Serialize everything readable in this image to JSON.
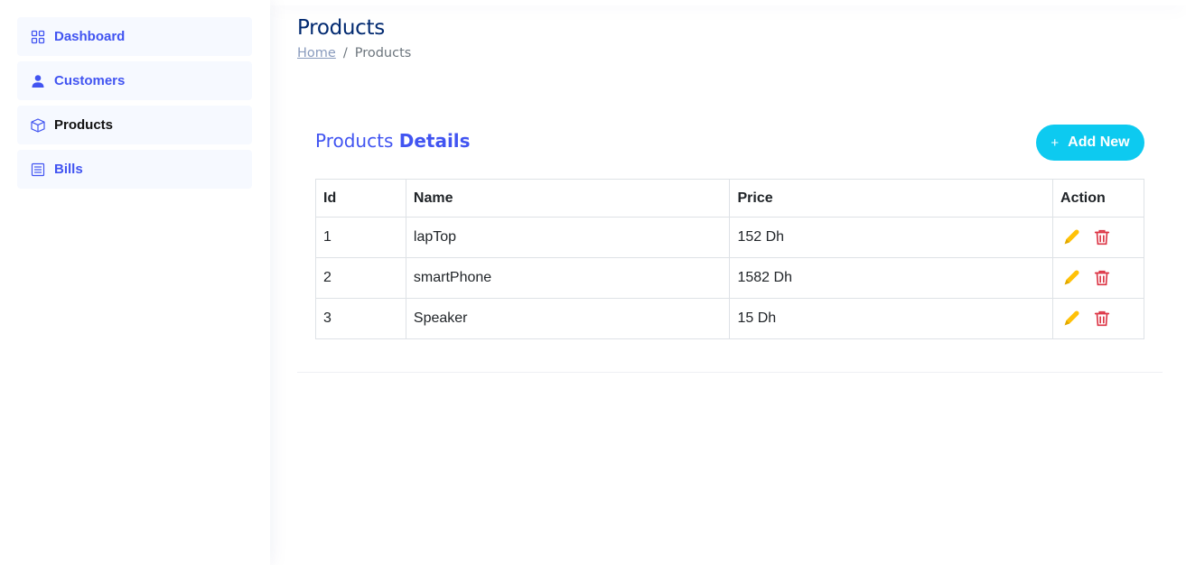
{
  "sidebar": {
    "items": [
      {
        "label": "Dashboard",
        "icon": "grid-icon"
      },
      {
        "label": "Customers",
        "icon": "person-icon"
      },
      {
        "label": "Products",
        "icon": "box-icon"
      },
      {
        "label": "Bills",
        "icon": "receipt-icon"
      }
    ]
  },
  "page": {
    "title": "Products",
    "breadcrumb": {
      "home": "Home",
      "separator": "/",
      "current": "Products"
    }
  },
  "card": {
    "title_prefix": "Products",
    "title_strong": "Details",
    "add_button": {
      "icon": "+",
      "label": "Add New"
    }
  },
  "table": {
    "headers": {
      "id": "Id",
      "name": "Name",
      "price": "Price",
      "action": "Action"
    },
    "rows": [
      {
        "id": "1",
        "name": "lapTop",
        "price": "152 Dh"
      },
      {
        "id": "2",
        "name": "smartPhone",
        "price": "1582 Dh"
      },
      {
        "id": "3",
        "name": "Speaker",
        "price": "15 Dh"
      }
    ]
  },
  "colors": {
    "accent": "#4154f1",
    "title": "#012970",
    "add_button": "#0dcaf0",
    "edit_icon": "#ffc107",
    "delete_icon": "#dc3545"
  }
}
